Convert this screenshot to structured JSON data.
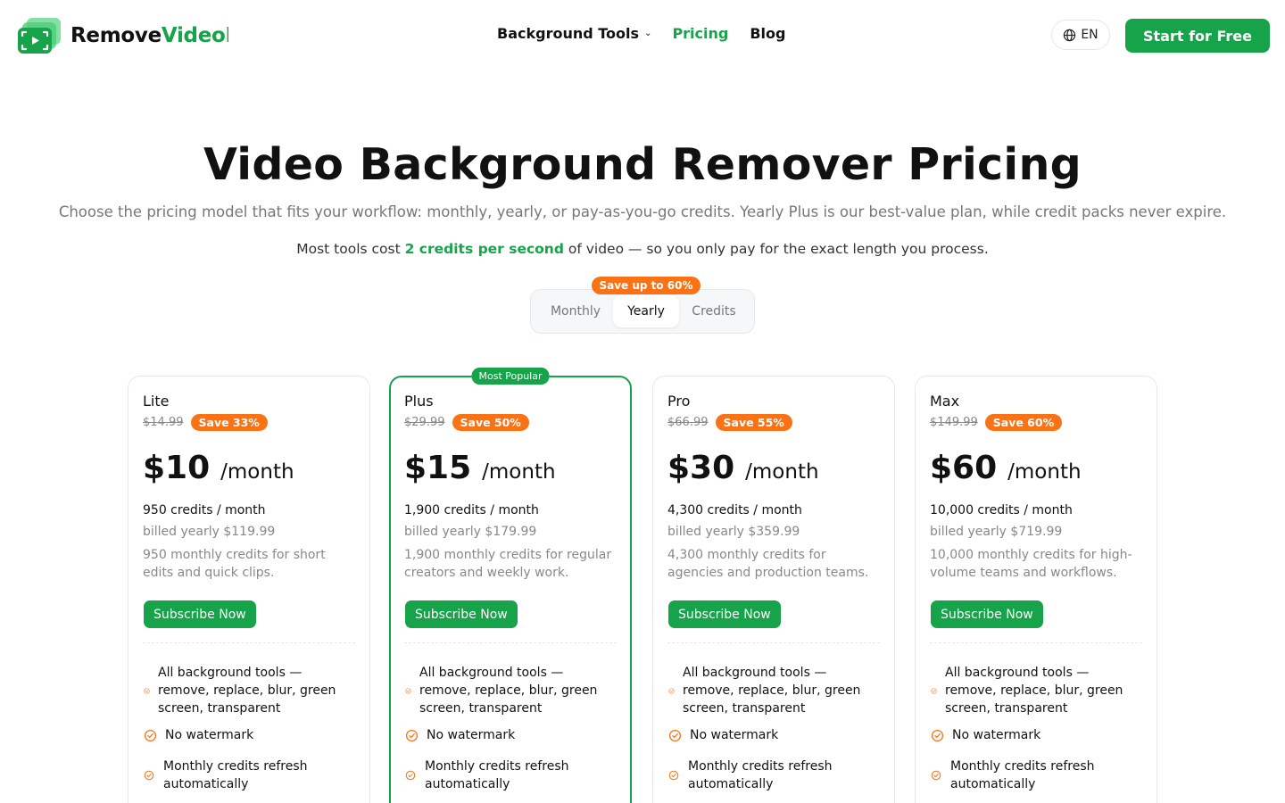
{
  "brand": {
    "name_part1": "Remove",
    "name_part2": "VideoBG",
    "primary_color": "#16a34a",
    "accent_color": "#f97316"
  },
  "nav": {
    "items": [
      {
        "label": "Background Tools",
        "has_dropdown": true,
        "active": false
      },
      {
        "label": "Pricing",
        "active": true
      },
      {
        "label": "Blog",
        "active": false
      }
    ]
  },
  "header": {
    "language": "EN",
    "cta_label": "Start for Free"
  },
  "hero": {
    "title": "Video Background Remover Pricing",
    "subtitle": "Choose the pricing model that fits your workflow: monthly, yearly, or pay-as-you-go credits. Yearly Plus is our best-value plan, while credit packs never expire.",
    "note_before": "Most tools cost ",
    "note_highlight": "2 credits per second",
    "note_after": " of video — so you only pay for the exact length you process."
  },
  "billing_toggle": {
    "badge": "Save up to 60%",
    "options": [
      "Monthly",
      "Yearly",
      "Credits"
    ],
    "selected": "Yearly"
  },
  "plans": [
    {
      "name": "Lite",
      "old_price": "$14.99",
      "save": "Save 33%",
      "price": "$10",
      "period": "/month",
      "credits": "950 credits / month",
      "billed": "billed yearly $119.99",
      "description": "950 monthly credits for short edits and quick clips.",
      "button": "Subscribe Now",
      "popular": false,
      "features": [
        "All background tools — remove, replace, blur, green screen, transparent",
        "No watermark",
        "Monthly credits refresh automatically"
      ]
    },
    {
      "name": "Plus",
      "old_price": "$29.99",
      "save": "Save 50%",
      "price": "$15",
      "period": "/month",
      "credits": "1,900 credits / month",
      "billed": "billed yearly $179.99",
      "description": "1,900 monthly credits for regular creators and weekly work.",
      "button": "Subscribe Now",
      "popular": true,
      "popular_label": "Most Popular",
      "features": [
        "All background tools — remove, replace, blur, green screen, transparent",
        "No watermark",
        "Monthly credits refresh automatically"
      ]
    },
    {
      "name": "Pro",
      "old_price": "$66.99",
      "save": "Save 55%",
      "price": "$30",
      "period": "/month",
      "credits": "4,300 credits / month",
      "billed": "billed yearly $359.99",
      "description": "4,300 monthly credits for agencies and production teams.",
      "button": "Subscribe Now",
      "popular": false,
      "features": [
        "All background tools — remove, replace, blur, green screen, transparent",
        "No watermark",
        "Monthly credits refresh automatically"
      ]
    },
    {
      "name": "Max",
      "old_price": "$149.99",
      "save": "Save 60%",
      "price": "$60",
      "period": "/month",
      "credits": "10,000 credits / month",
      "billed": "billed yearly $719.99",
      "description": "10,000 monthly credits for high-volume teams and workflows.",
      "button": "Subscribe Now",
      "popular": false,
      "features": [
        "All background tools — remove, replace, blur, green screen, transparent",
        "No watermark",
        "Monthly credits refresh automatically"
      ]
    }
  ],
  "icons": {
    "feature": "check-circle-icon",
    "language": "globe-icon",
    "dropdown": "chevron-down-icon"
  }
}
